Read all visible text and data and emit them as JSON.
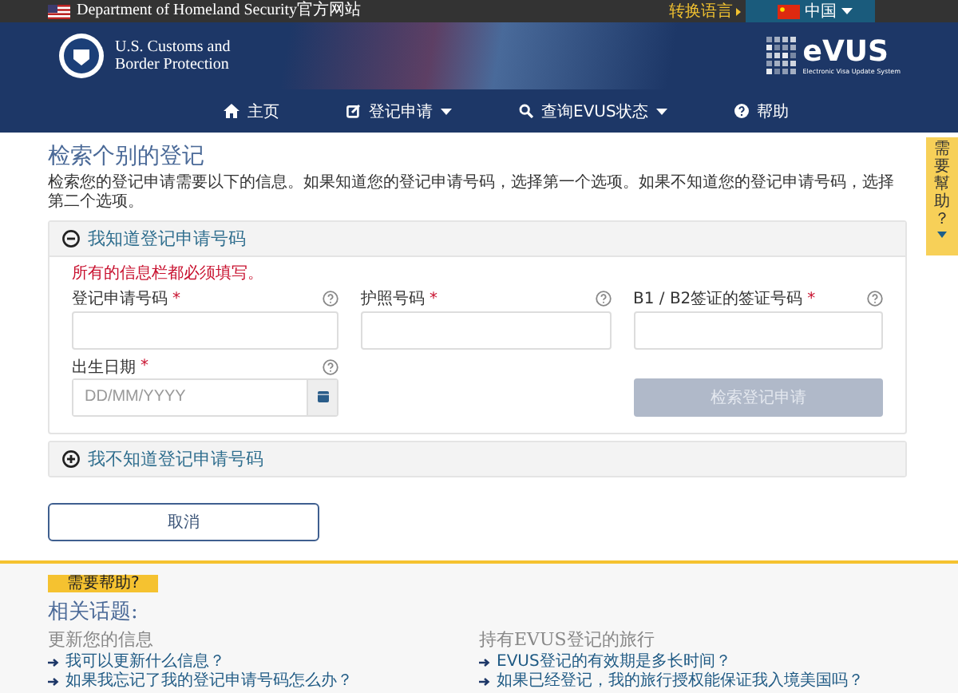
{
  "top_bar": {
    "site_label": "Department of Homeland Security官方网站",
    "language_prompt": "转换语言",
    "language": "中国"
  },
  "header": {
    "agency_lines": [
      "U.S. Customs and",
      "Border Protection"
    ],
    "logo": {
      "name": "eVUS",
      "subtitle": "Electronic Visa Update System"
    }
  },
  "nav": [
    {
      "label": "主页",
      "kind": "home",
      "dropdown": false
    },
    {
      "label": "登记申请",
      "kind": "edit",
      "dropdown": true
    },
    {
      "label": "查询EVUS状态",
      "kind": "search",
      "dropdown": true
    },
    {
      "label": "帮助",
      "kind": "help",
      "dropdown": false
    }
  ],
  "page": {
    "title": "检索个别的登记",
    "description": "检索您的登记申请需要以下的信息。如果知道您的登记申请号码，选择第一个选项。如果不知道您的登记申请号码，选择第二个选项。"
  },
  "panels": [
    {
      "title": "我知道登记申请号码",
      "expanded": true
    },
    {
      "title": "我不知道登记申请号码",
      "expanded": false
    }
  ],
  "form": {
    "required_note": "所有的信息栏都必须填写。",
    "required_mark": "*",
    "fields": [
      {
        "label": "登记申请号码",
        "kind": "text",
        "required": true
      },
      {
        "label": "护照号码",
        "kind": "text",
        "required": true
      },
      {
        "label": "B1 / B2签证的签证号码",
        "kind": "text",
        "required": true
      },
      {
        "label": "出生日期",
        "kind": "date",
        "required": true,
        "placeholder": "DD/MM/YYYY"
      }
    ],
    "search_button": {
      "label": "检索登记申请",
      "disabled": true
    }
  },
  "cancel_button": "取消",
  "help_tab": {
    "label": "需要幫助？"
  },
  "footer": {
    "tab": "需要帮助?",
    "heading": "相关话题:",
    "columns": [
      {
        "heading": "更新您的信息",
        "links": [
          "我可以更新什么信息？",
          "如果我忘记了我的登记申请号码怎么办？"
        ]
      },
      {
        "heading": "持有EVUS登记的旅行",
        "links": [
          "EVUS登记的有效期是多长时间？",
          "如果已经登记，我的旅行授权能保证我入境美国吗？"
        ]
      }
    ]
  }
}
